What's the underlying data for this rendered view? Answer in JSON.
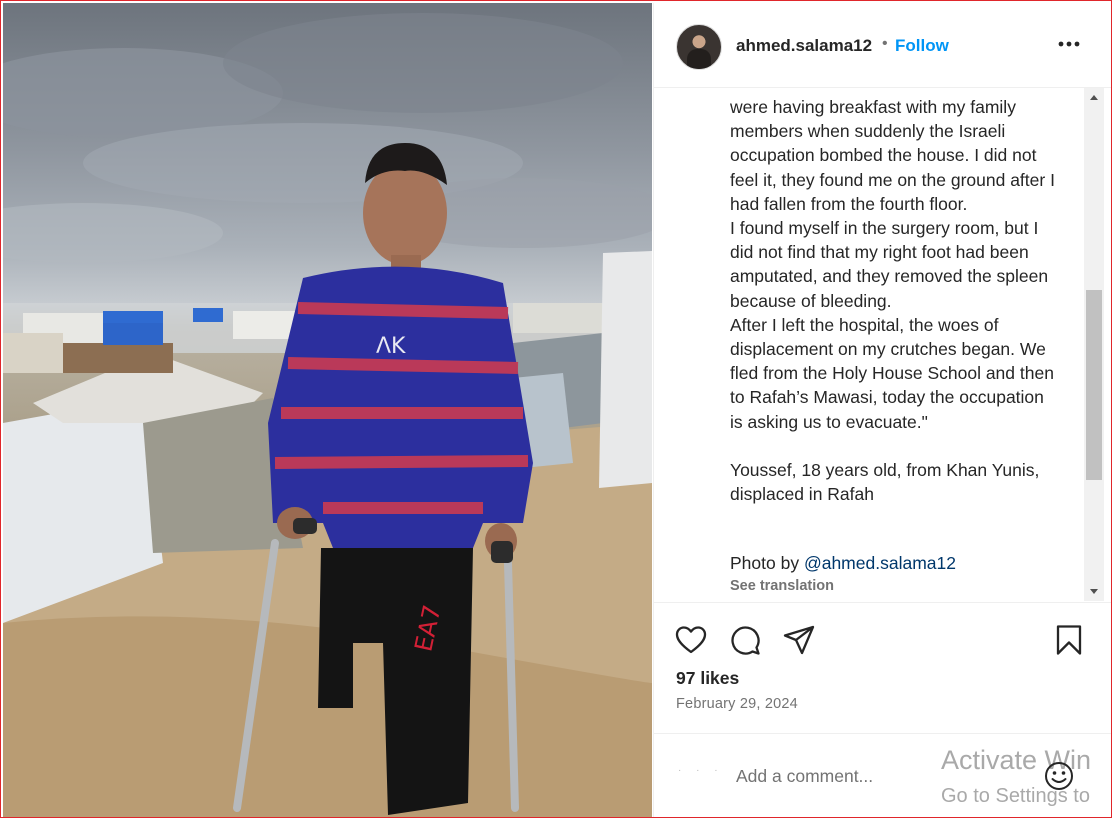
{
  "post": {
    "username": "ahmed.salama12",
    "separator": "•",
    "follow_label": "Follow",
    "more_icon": "more-horizontal-icon",
    "caption_top_fragment": "…",
    "caption": "were having breakfast with my family members when suddenly the Israeli occupation bombed the house. I did not feel it, they found me on the ground after I had fallen from the fourth floor.\nI found myself in the surgery room, but I did not find that my right foot had been amputated, and they removed the spleen because of bleeding.\nAfter I left the hospital, the woes of displacement on my crutches began. We fled from the Holy House School and then to Rafah’s Mawasi, today the occupation is asking us to evacuate.\"\n\nYoussef, 18 years old, from Khan Yunis, displaced in Rafah",
    "photo_by_prefix": "Photo by ",
    "photo_by_handle": "@ahmed.salama12",
    "see_translation": "See translation",
    "likes": "97 likes",
    "date": "February 29, 2024",
    "comment_placeholder": "Add a comment..."
  },
  "icons": {
    "like": "heart-icon",
    "comment": "comment-icon",
    "share": "share-icon",
    "save": "bookmark-icon",
    "emoji": "emoji-icon"
  },
  "overlay": {
    "activate_title": "Activate Win",
    "activate_sub": "Go to Settings to"
  },
  "colors": {
    "accent": "#0095f6",
    "text": "#262626",
    "muted": "#737373",
    "link": "#00376b",
    "frame_border": "#e0262b"
  }
}
